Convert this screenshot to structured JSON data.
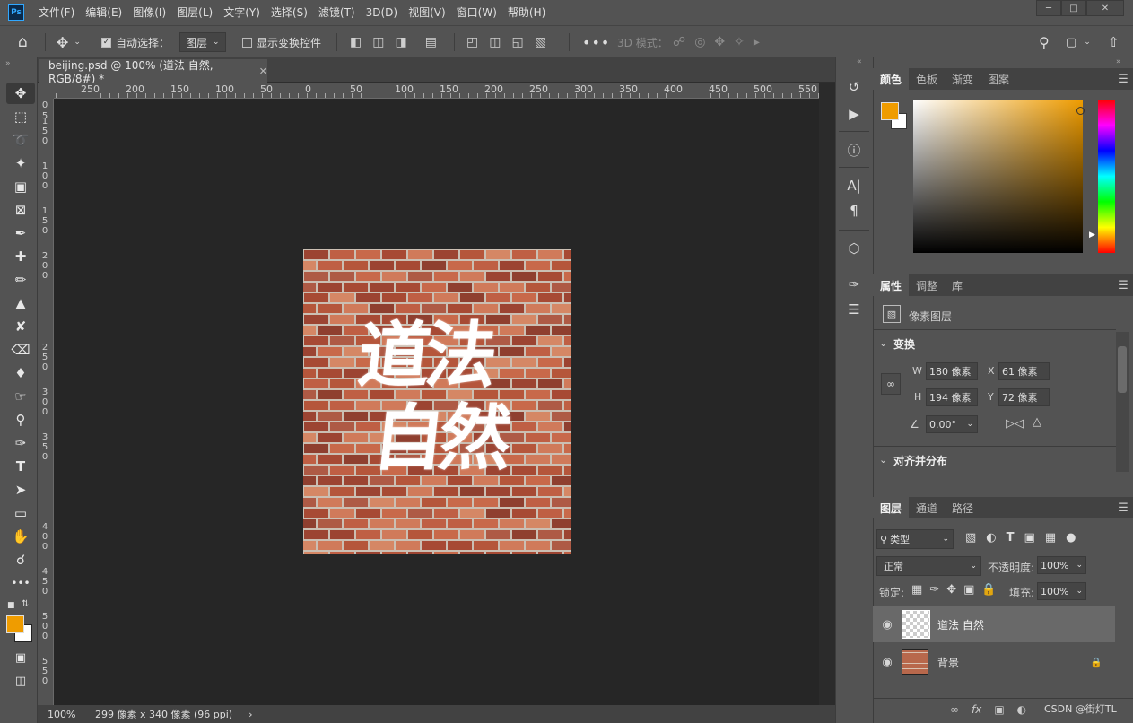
{
  "menubar": {
    "logo": "Ps",
    "items": [
      "文件(F)",
      "编辑(E)",
      "图像(I)",
      "图层(L)",
      "文字(Y)",
      "选择(S)",
      "滤镜(T)",
      "3D(D)",
      "视图(V)",
      "窗口(W)",
      "帮助(H)"
    ]
  },
  "options": {
    "auto_select_label": "自动选择：",
    "auto_select_target": "图层",
    "show_transform_label": "显示变换控件",
    "mode_3d_label": "3D 模式："
  },
  "document": {
    "tab_title": "beijing.psd @ 100% (道法 自然, RGB/8#) *",
    "canvas_text_line1": "道法",
    "canvas_text_line2": "自然",
    "h_ruler_labels": [
      "250",
      "200",
      "150",
      "100",
      "50",
      "0",
      "50",
      "100",
      "150",
      "200",
      "250",
      "300",
      "350",
      "400",
      "450",
      "500",
      "550"
    ],
    "v_ruler_labels": [
      "0",
      "5",
      "1\n5\n0",
      "1\n0\n0",
      "1\n5\n0",
      "2\n0\n0",
      "2\n5\n0",
      "3\n0\n0",
      "3\n5\n0",
      "4\n0\n0",
      "4\n5\n0",
      "5\n0\n0",
      "5\n5\n0"
    ]
  },
  "status": {
    "zoom": "100%",
    "doc_size": "299 像素 x 340 像素 (96 ppi)"
  },
  "colors": {
    "foreground": "#ef9c00",
    "background": "#ffffff",
    "accent": "#31a8ff"
  },
  "color_panel": {
    "tabs": [
      "颜色",
      "色板",
      "渐变",
      "图案"
    ]
  },
  "properties_panel": {
    "tabs": [
      "属性",
      "调整",
      "库"
    ],
    "layer_type": "像素图层",
    "transform_title": "变换",
    "w_label": "W",
    "w_value": "180 像素",
    "x_label": "X",
    "x_value": "61 像素",
    "h_label": "H",
    "h_value": "194 像素",
    "y_label": "Y",
    "y_value": "72 像素",
    "angle_value": "0.00°",
    "align_title": "对齐并分布"
  },
  "layers_panel": {
    "tabs": [
      "图层",
      "通道",
      "路径"
    ],
    "filter_kind": "类型",
    "blend_mode": "正常",
    "opacity_label": "不透明度:",
    "opacity_value": "100%",
    "lock_label": "锁定:",
    "fill_label": "填充:",
    "fill_value": "100%",
    "layers": [
      {
        "name": "道法 自然"
      },
      {
        "name": "背景"
      }
    ],
    "footer_fx": "fx",
    "watermark": "CSDN @街灯TL"
  }
}
